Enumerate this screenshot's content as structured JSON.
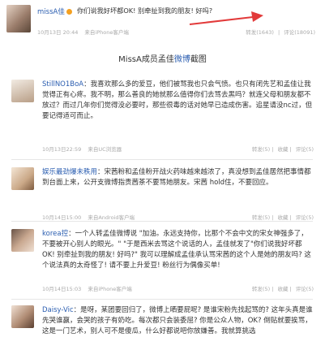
{
  "top_post": {
    "username": "missA佳",
    "text": "你们说我好坏都OK! 别牵扯到我的朋友! 好吗?",
    "time": "10月13日 20:44",
    "source": "来自iPhone客户端",
    "repost": "转发(1643)",
    "comment": "评论(18091)",
    "divider": "|"
  },
  "caption": {
    "prefix": "MissA成员孟佳",
    "link": "微博",
    "suffix": "截图"
  },
  "comments": [
    {
      "username": "StillNO1BoA",
      "text": "：我喜欢那么多的爱豆，他们被骂我也只会气愤。也只有闭先艺和孟佳让我觉得正有心疼。我不明，那么善良的她就那么值得你们去骂去黑吗？就连父母和朋友都不放过？而过几年你们觉得没必要时，那些很毒的话对她早已造成伤害。追星请没nc过，但要记得适可而止。",
      "time": "10月13日22:59",
      "source": "来自UC浏览器",
      "repost": "转发(5)",
      "collect": "收藏",
      "comment": "评论(5)"
    },
    {
      "username": "娱乐最劲爆未秩用",
      "text": "：宋茜粉和孟佳粉开战火药味越来越浓了，真没想到孟佳居然把事情都到台面上来，公开支微博指责茜茶不要骂她朋友。宋茜 hold住，不要回应。",
      "time": "10月14日15:00",
      "source": "来自Android客户端",
      "repost": "转发(5)",
      "collect": "收藏",
      "comment": "评论(5)"
    },
    {
      "username": "korea控",
      "text": "：一个人转孟佳微博说 \"加油。永远支持你，比那个不会中文的宋女神强多了，不要被开心别人的眼光。\" \"于是西米去骂这个说话的人，孟佳就发了\"你们说我好坏都OK! 别牵扯到我的朋友! 好吗?\" 我可以理解成孟佳承认骂宋茜的这个人是她的朋友吗? 这个说法真的太奇怪了! 请不要上升爱豆! 粉丝行为偶像买单!",
      "time": "10月14日15:03",
      "source": "来自iPhone客户端",
      "repost": "转发(5)",
      "collect": "收藏",
      "comment": "评论(5)"
    },
    {
      "username": "Daisy-Vic",
      "text": "：是呀，某团要回归了，微博上晒要屁呢? 是谁宋粉先找起骂的? 这年头真是谁先哭谁赢，会哭的孩子有奶吃。每次都只会装委屈? 你是公众人物，OK? 倒贴就要挨骂，这是一门艺术，别人可不是傻瓜，什么好都说吧你放嫌善。我就算挑选",
      "time": "",
      "source": "",
      "repost": "",
      "collect": "",
      "comment": ""
    }
  ],
  "colors": {
    "link": "#2a5db0",
    "highlight": "#d0201a",
    "arrow": "#e23a3a"
  }
}
